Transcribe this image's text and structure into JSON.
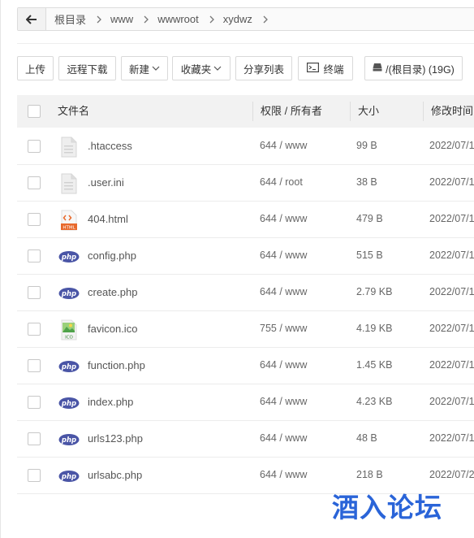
{
  "breadcrumb": {
    "items": [
      "根目录",
      "www",
      "wwwroot",
      "xydwz"
    ]
  },
  "toolbar": {
    "upload_label": "上传",
    "remote_download_label": "远程下载",
    "new_label": "新建",
    "favorites_label": "收藏夹",
    "share_list_label": "分享列表",
    "terminal_label": "终端",
    "disk_label": "/(根目录) (19G)"
  },
  "table": {
    "headers": {
      "name": "文件名",
      "perm": "权限 / 所有者",
      "size": "大小",
      "mtime": "修改时间"
    },
    "rows": [
      {
        "name": ".htaccess",
        "icon": "text-file-icon",
        "perm": "644 / www",
        "size": "99 B",
        "mtime": "2022/07/1"
      },
      {
        "name": ".user.ini",
        "icon": "text-file-icon",
        "perm": "644 / root",
        "size": "38 B",
        "mtime": "2022/07/1"
      },
      {
        "name": "404.html",
        "icon": "html-file-icon",
        "perm": "644 / www",
        "size": "479 B",
        "mtime": "2022/07/1"
      },
      {
        "name": "config.php",
        "icon": "php-file-icon",
        "perm": "644 / www",
        "size": "515 B",
        "mtime": "2022/07/1"
      },
      {
        "name": "create.php",
        "icon": "php-file-icon",
        "perm": "644 / www",
        "size": "2.79 KB",
        "mtime": "2022/07/1"
      },
      {
        "name": "favicon.ico",
        "icon": "ico-file-icon",
        "perm": "755 / www",
        "size": "4.19 KB",
        "mtime": "2022/07/1"
      },
      {
        "name": "function.php",
        "icon": "php-file-icon",
        "perm": "644 / www",
        "size": "1.45 KB",
        "mtime": "2022/07/1"
      },
      {
        "name": "index.php",
        "icon": "php-file-icon",
        "perm": "644 / www",
        "size": "4.23 KB",
        "mtime": "2022/07/1"
      },
      {
        "name": "urls123.php",
        "icon": "php-file-icon",
        "perm": "644 / www",
        "size": "48 B",
        "mtime": "2022/07/1"
      },
      {
        "name": "urlsabc.php",
        "icon": "php-file-icon",
        "perm": "644 / www",
        "size": "218 B",
        "mtime": "2022/07/2"
      }
    ]
  },
  "watermark": {
    "text": "酒入论坛"
  },
  "colors": {
    "php_badge": "#4a55a6",
    "html_badge": "#e8692c",
    "watermark": "#2a64d8"
  }
}
